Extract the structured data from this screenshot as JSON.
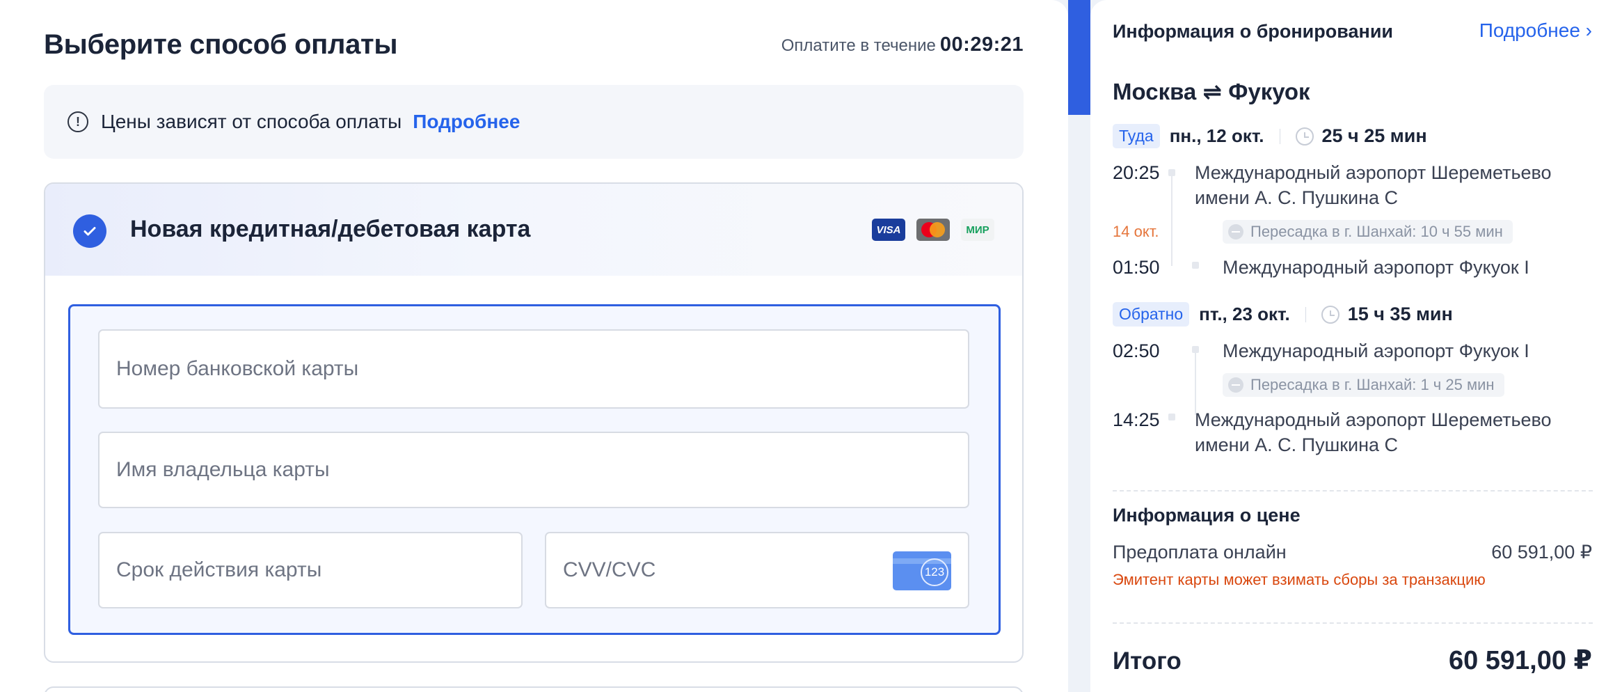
{
  "payment": {
    "title": "Выберите способ оплаты",
    "timer_label": "Оплатите в течение",
    "timer_value": "00:29:21",
    "price_note": "Цены зависят от способа оплаты",
    "price_note_link": "Подробнее",
    "card_method_title": "Новая кредитная/дебетовая карта",
    "brands": [
      "VISA",
      "Mastercard",
      "МИР"
    ],
    "fields": {
      "card_number_placeholder": "Номер банковской карты",
      "card_holder_placeholder": "Имя владельца карты",
      "expiry_placeholder": "Срок действия карты",
      "cvv_placeholder": "CVV/CVC",
      "cvv_hint": "123"
    },
    "accent_color": "#2f5fe0"
  },
  "booking": {
    "title": "Информация о бронировании",
    "more_link": "Подробнее ›",
    "route": "Москва ⇌ Фукуок",
    "outbound": {
      "direction": "Туда",
      "date": "пн., 12 окт.",
      "duration": "25 ч 25 мин",
      "dep_time": "20:25",
      "dep_airport": "Международный аэропорт Шереметьево имени А. С. Пушкина C",
      "arrival_date_note": "14 окт.",
      "transfer": "Пересадка в г. Шанхай: 10 ч 55 мин",
      "arr_time": "01:50",
      "arr_airport": "Международный аэропорт Фукуок I"
    },
    "return": {
      "direction": "Обратно",
      "date": "пт., 23 окт.",
      "duration": "15 ч 35 мин",
      "dep_time": "02:50",
      "dep_airport": "Международный аэропорт Фукуок I",
      "transfer": "Пересадка в г. Шанхай: 1 ч 25 мин",
      "arr_time": "14:25",
      "arr_airport": "Международный аэропорт Шереметьево имени А. С. Пушкина C"
    },
    "price": {
      "title": "Информация о цене",
      "prepay_label": "Предоплата онлайн",
      "prepay_value": "60 591,00 ₽",
      "fee_note": "Эмитент карты может взимать сборы за транзакцию",
      "total_label": "Итого",
      "total_value": "60 591,00 ₽"
    }
  }
}
